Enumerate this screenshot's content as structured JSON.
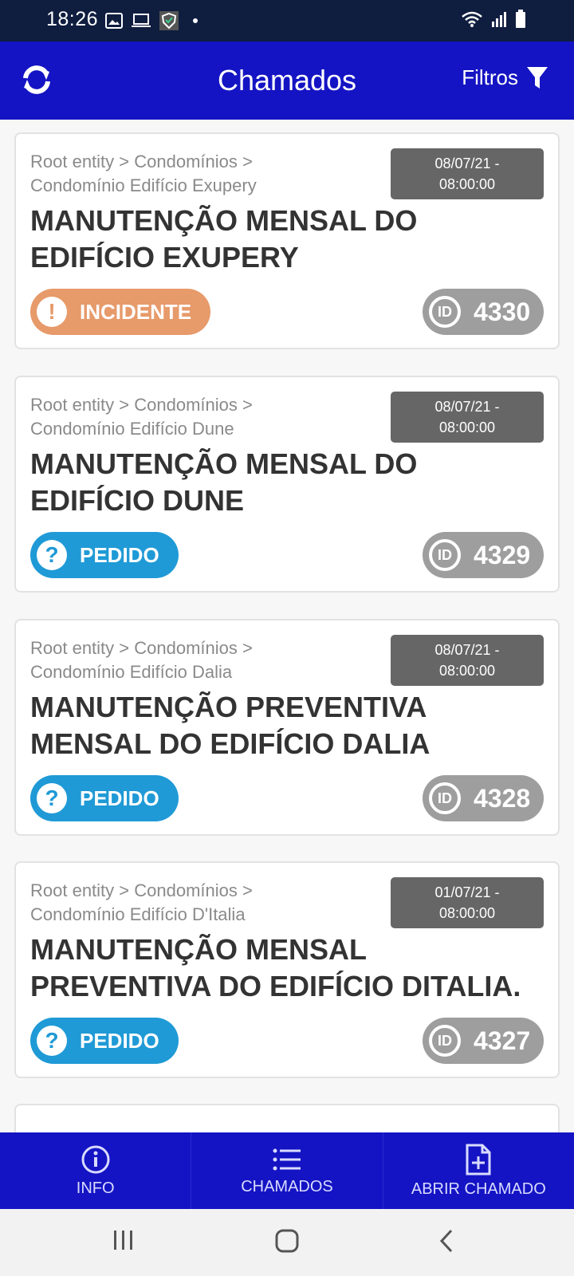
{
  "status_bar": {
    "time": "18:26",
    "icons_left": [
      "image-icon",
      "laptop-icon",
      "shield-check-icon",
      "dot-icon"
    ],
    "icons_right": [
      "wifi-icon",
      "signal-icon",
      "battery-icon"
    ]
  },
  "app_bar": {
    "title": "Chamados",
    "filters_label": "Filtros",
    "refresh_icon": "refresh-icon",
    "filter_icon": "filter-icon"
  },
  "colors": {
    "app_bar": "#1414c4",
    "status_bar": "#0f1d3f",
    "incidente": "#e79a6a",
    "pedido": "#1f9ad6",
    "id_pill": "#9e9e9e",
    "date_badge": "#666666"
  },
  "tickets": [
    {
      "path_line1": "Root entity > Condomínios >",
      "path_line2": "Condomínio Edifício Exupery",
      "date_line1": "08/07/21 -",
      "date_line2": "08:00:00",
      "title": "MANUTENÇÃO MENSAL DO EDIFÍCIO EXUPERY",
      "type": "INCIDENTE",
      "type_icon": "!",
      "id": "4330"
    },
    {
      "path_line1": "Root entity > Condomínios >",
      "path_line2": "Condomínio Edifício Dune",
      "date_line1": "08/07/21 -",
      "date_line2": "08:00:00",
      "title": "MANUTENÇÃO MENSAL DO EDIFÍCIO DUNE",
      "type": "PEDIDO",
      "type_icon": "?",
      "id": "4329"
    },
    {
      "path_line1": "Root entity > Condomínios >",
      "path_line2": "Condomínio Edifício Dalia",
      "date_line1": "08/07/21 -",
      "date_line2": "08:00:00",
      "title": "MANUTENÇÃO PREVENTIVA MENSAL DO EDIFÍCIO DALIA",
      "type": "PEDIDO",
      "type_icon": "?",
      "id": "4328"
    },
    {
      "path_line1": "Root entity > Condomínios >",
      "path_line2": "Condomínio Edifício D'Italia",
      "date_line1": "01/07/21 -",
      "date_line2": "08:00:00",
      "title": "MANUTENÇÃO MENSAL PREVENTIVA DO EDIFÍCIO DITALIA.",
      "type": "PEDIDO",
      "type_icon": "?",
      "id": "4327"
    }
  ],
  "id_icon_label": "ID",
  "bottom_nav": [
    {
      "label": "INFO",
      "icon": "info-icon"
    },
    {
      "label": "CHAMADOS",
      "icon": "list-icon"
    },
    {
      "label": "ABRIR CHAMADO",
      "icon": "add-file-icon"
    }
  ],
  "system_nav": [
    "recents-icon",
    "home-icon",
    "back-icon"
  ]
}
